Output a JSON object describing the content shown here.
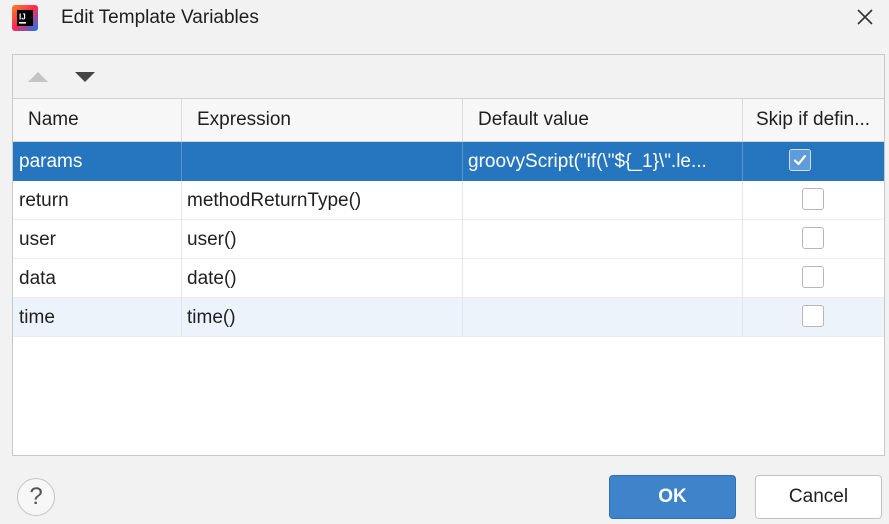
{
  "window": {
    "title": "Edit Template Variables",
    "app_icon": "intellij-idea-icon",
    "close_icon": "close-icon"
  },
  "toolbar": {
    "move_up_icon": "triangle-up-icon",
    "move_down_icon": "triangle-down-icon"
  },
  "table": {
    "columns": [
      "Name",
      "Expression",
      "Default value",
      "Skip if defin..."
    ],
    "rows": [
      {
        "name": "params",
        "expression": "",
        "default_value": "groovyScript(\"if(\\\"${_1}\\\".le...",
        "skip_if_defined": true
      },
      {
        "name": "return",
        "expression": "methodReturnType()",
        "default_value": "",
        "skip_if_defined": false
      },
      {
        "name": "user",
        "expression": "user()",
        "default_value": "",
        "skip_if_defined": false
      },
      {
        "name": "data",
        "expression": "date()",
        "default_value": "",
        "skip_if_defined": false
      },
      {
        "name": "time",
        "expression": "time()",
        "default_value": "",
        "skip_if_defined": false
      }
    ],
    "selected_row": 0
  },
  "footer": {
    "help_label": "?",
    "ok_label": "OK",
    "cancel_label": "Cancel"
  },
  "colors": {
    "selection": "#2675bf",
    "hover_row": "#edf3fb",
    "ok_button": "#3f83cb"
  }
}
